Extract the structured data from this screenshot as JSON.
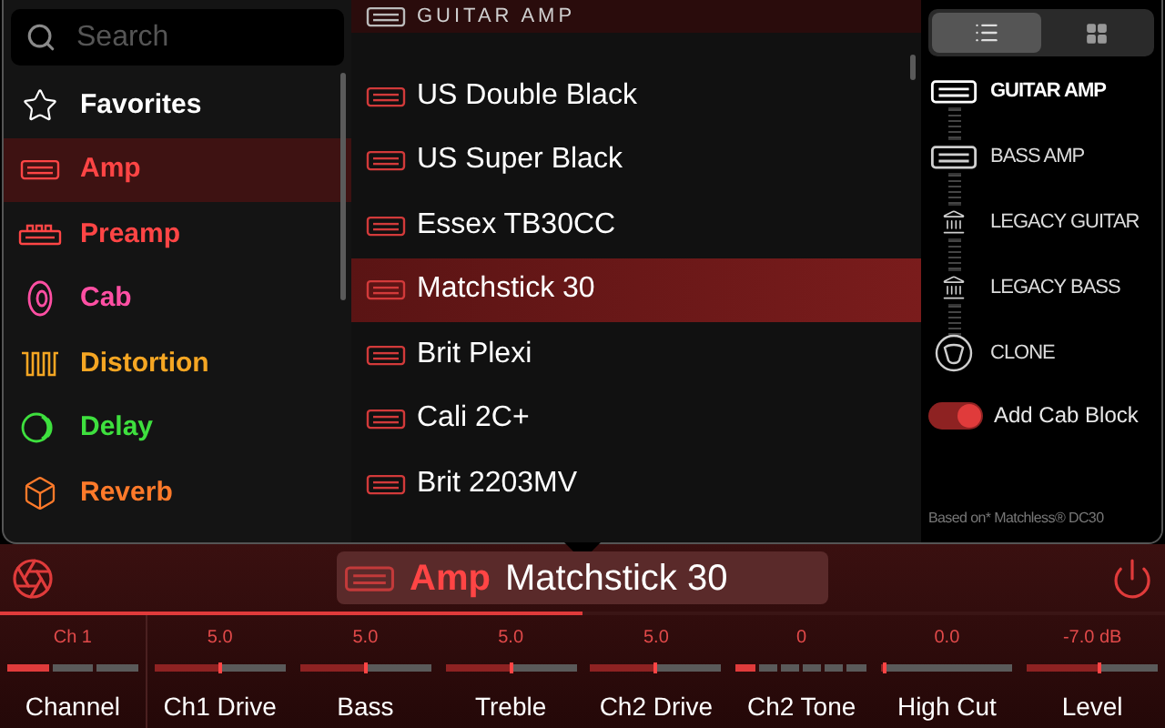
{
  "search": {
    "placeholder": "Search"
  },
  "categories": [
    {
      "label": "Favorites",
      "kind": "star",
      "color": "#ffffff",
      "selected": false
    },
    {
      "label": "Amp",
      "kind": "amp",
      "color": "#ff4545",
      "selected": true
    },
    {
      "label": "Preamp",
      "kind": "preamp",
      "color": "#ff4545",
      "selected": false
    },
    {
      "label": "Cab",
      "kind": "cab",
      "color": "#ff4fa3",
      "selected": false
    },
    {
      "label": "Distortion",
      "kind": "distortion",
      "color": "#f5a623",
      "selected": false
    },
    {
      "label": "Delay",
      "kind": "delay",
      "color": "#3ee03e",
      "selected": false
    },
    {
      "label": "Reverb",
      "kind": "reverb",
      "color": "#ff7a2a",
      "selected": false
    }
  ],
  "model_list": {
    "header": "GUITAR AMP",
    "items": [
      {
        "label": "US Double Black",
        "selected": false
      },
      {
        "label": "US Super Black",
        "selected": false
      },
      {
        "label": "Essex TB30CC",
        "selected": false
      },
      {
        "label": "Matchstick 30",
        "selected": true
      },
      {
        "label": "Brit Plexi",
        "selected": false
      },
      {
        "label": "Cali 2C+",
        "selected": false
      },
      {
        "label": "Brit 2203MV",
        "selected": false
      }
    ]
  },
  "view_toggle": [
    {
      "kind": "list",
      "selected": true
    },
    {
      "kind": "grid",
      "selected": false
    }
  ],
  "amp_types": [
    {
      "label": "GUITAR AMP",
      "kind": "head",
      "selected": true
    },
    {
      "label": "BASS AMP",
      "kind": "head",
      "selected": false
    },
    {
      "label": "LEGACY GUITAR",
      "kind": "legacy",
      "selected": false
    },
    {
      "label": "LEGACY BASS",
      "kind": "legacy",
      "selected": false
    },
    {
      "label": "CLONE",
      "kind": "clone",
      "selected": false
    }
  ],
  "cab_toggle": {
    "label": "Add Cab Block",
    "on": true
  },
  "based_on": "Based on* Matchless® DC30",
  "block": {
    "category": "Amp",
    "model": "Matchstick 30"
  },
  "params": [
    {
      "kind": "channel",
      "value": "Ch 1",
      "label": "Channel",
      "level": 0.33
    },
    {
      "kind": "knob",
      "value": "5.0",
      "label": "Ch1 Drive",
      "level": 0.5
    },
    {
      "kind": "knob",
      "value": "5.0",
      "label": "Bass",
      "level": 0.5
    },
    {
      "kind": "knob",
      "value": "5.0",
      "label": "Treble",
      "level": 0.5
    },
    {
      "kind": "knob",
      "value": "5.0",
      "label": "Ch2 Drive",
      "level": 0.5
    },
    {
      "kind": "stepped",
      "value": "0",
      "label": "Ch2 Tone",
      "level": 0.17
    },
    {
      "kind": "knob",
      "value": "0.0",
      "label": "High Cut",
      "level": 0.02
    },
    {
      "kind": "knob",
      "value": "-7.0 dB",
      "label": "Level",
      "level": 0.55
    }
  ]
}
